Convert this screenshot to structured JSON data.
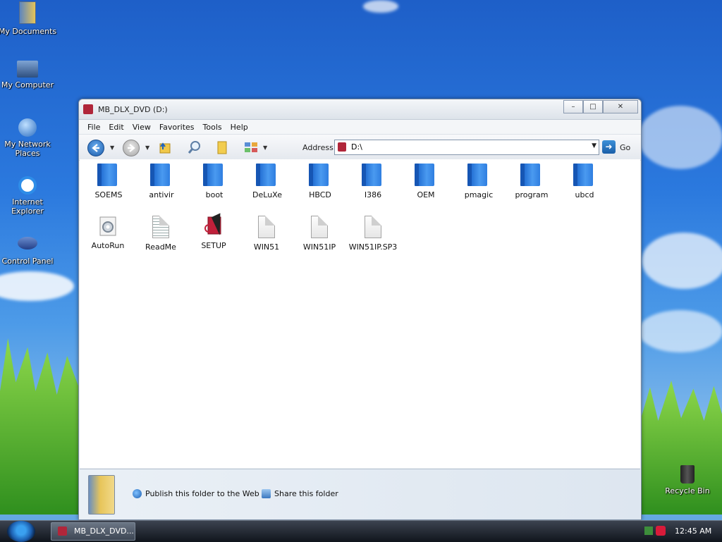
{
  "desktop": {
    "icons": [
      {
        "label": "My Documents",
        "icon": "my-documents-icon"
      },
      {
        "label": "My Computer",
        "icon": "computer-icon"
      },
      {
        "label": "My Network Places",
        "icon": "network-icon"
      },
      {
        "label": "Internet Explorer",
        "icon": "ie-icon"
      },
      {
        "label": "Control Panel",
        "icon": "control-panel-icon"
      },
      {
        "label": "Recycle Bin",
        "icon": "recycle-bin-icon"
      }
    ]
  },
  "window": {
    "title": "MB_DLX_DVD (D:)",
    "minimize_glyph": "–",
    "maximize_glyph": "□",
    "close_glyph": "✕"
  },
  "menu": [
    "File",
    "Edit",
    "View",
    "Favorites",
    "Tools",
    "Help"
  ],
  "toolbar": {
    "address_label": "Address",
    "address_value": "D:\\",
    "go_label": "Go"
  },
  "folders": [
    "SOEMS",
    "antivir",
    "boot",
    "DeLuXe",
    "HBCD",
    "I386",
    "OEM",
    "pmagic",
    "program",
    "ubcd"
  ],
  "files": [
    {
      "name": "AutoRun",
      "icon": "autorun-gear-icon"
    },
    {
      "name": "ReadMe",
      "icon": "text-file-icon"
    },
    {
      "name": "SETUP",
      "icon": "setup-icon"
    },
    {
      "name": "WIN51",
      "icon": "file-icon"
    },
    {
      "name": "WIN51IP",
      "icon": "file-icon"
    },
    {
      "name": "WIN51IP.SP3",
      "icon": "file-icon"
    }
  ],
  "taskpane": {
    "publish_label": "Publish this folder to the Web",
    "share_label": "Share this folder"
  },
  "taskbar": {
    "task_label": "MB_DLX_DVD...",
    "clock": "12:45 AM"
  },
  "colors": {
    "sky": "#2b79de",
    "folder_blue": "#2f7ee0",
    "app_red": "#b0263a"
  }
}
